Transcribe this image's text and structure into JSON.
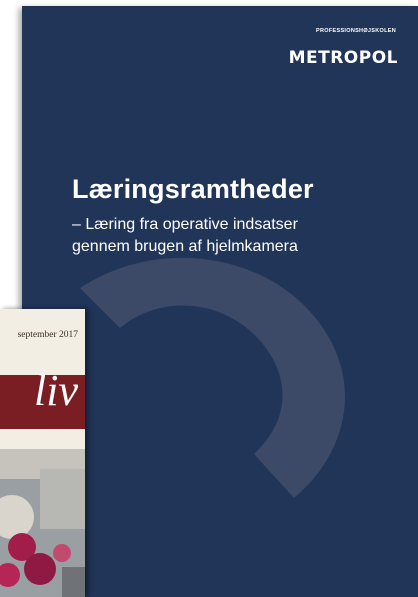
{
  "report": {
    "institution": "PROFESSIONSHØJSKOLEN",
    "logo": "METROPOL",
    "title": "Læringsramtheder",
    "subtitle_lines": [
      "– Læring fra operative indsatser",
      "gennem brugen af hjelmkamera"
    ],
    "colors": {
      "background": "#203558",
      "arc": "#3c4a67"
    }
  },
  "magazine": {
    "date": "september 2017",
    "masthead": "liv",
    "colors": {
      "band": "#7a1e23",
      "paper": "#f3eee4"
    }
  }
}
